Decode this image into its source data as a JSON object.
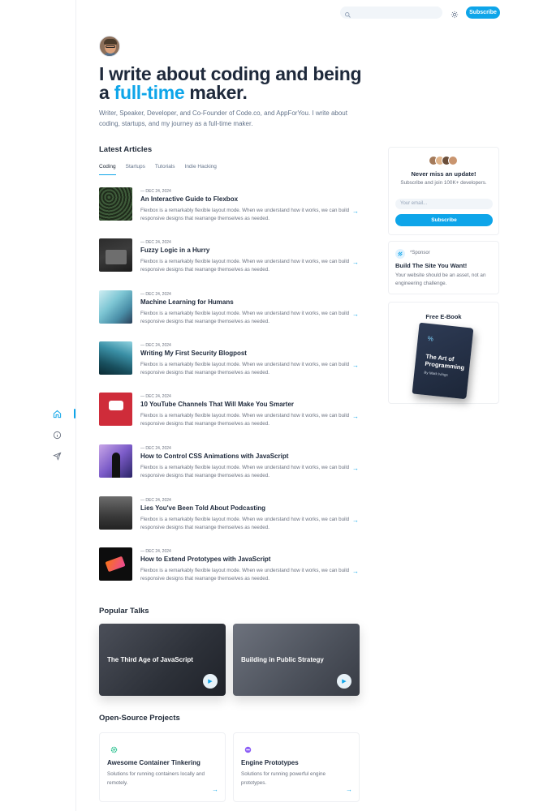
{
  "header": {
    "subscribe_label": "Subscribe"
  },
  "hero": {
    "title_part1": "I write about coding and being a ",
    "title_accent": "full-time",
    "title_part2": " maker.",
    "intro": "Writer, Speaker, Developer, and Co-Founder of Code.co, and AppForYou. I write about coding, startups, and my journey as a full-time maker."
  },
  "latest": {
    "heading": "Latest Articles",
    "tabs": [
      {
        "label": "Coding",
        "active": true
      },
      {
        "label": "Startups",
        "active": false
      },
      {
        "label": "Tutorials",
        "active": false
      },
      {
        "label": "Indie Hacking",
        "active": false
      }
    ],
    "articles": [
      {
        "date": "— DEC 24, 2024",
        "title": "An Interactive Guide to Flexbox",
        "desc": "Flexbox is a remarkably flexible layout mode. When we understand how it works, we can build responsive designs that rearrange themselves as needed."
      },
      {
        "date": "— DEC 24, 2024",
        "title": "Fuzzy Logic in a Hurry",
        "desc": "Flexbox is a remarkably flexible layout mode. When we understand how it works, we can build responsive designs that rearrange themselves as needed."
      },
      {
        "date": "— DEC 24, 2024",
        "title": "Machine Learning for Humans",
        "desc": "Flexbox is a remarkably flexible layout mode. When we understand how it works, we can build responsive designs that rearrange themselves as needed."
      },
      {
        "date": "— DEC 24, 2024",
        "title": "Writing My First Security Blogpost",
        "desc": "Flexbox is a remarkably flexible layout mode. When we understand how it works, we can build responsive designs that rearrange themselves as needed."
      },
      {
        "date": "— DEC 24, 2024",
        "title": "10 YouTube Channels That Will Make You Smarter",
        "desc": "Flexbox is a remarkably flexible layout mode. When we understand how it works, we can build responsive designs that rearrange themselves as needed."
      },
      {
        "date": "— DEC 24, 2024",
        "title": "How to Control CSS Animations with JavaScript",
        "desc": "Flexbox is a remarkably flexible layout mode. When we understand how it works, we can build responsive designs that rearrange themselves as needed."
      },
      {
        "date": "— DEC 24, 2024",
        "title": "Lies You've Been Told About Podcasting",
        "desc": "Flexbox is a remarkably flexible layout mode. When we understand how it works, we can build responsive designs that rearrange themselves as needed."
      },
      {
        "date": "— DEC 24, 2024",
        "title": "How to Extend Prototypes with JavaScript",
        "desc": "Flexbox is a remarkably flexible layout mode. When we understand how it works, we can build responsive designs that rearrange themselves as needed."
      }
    ]
  },
  "talks": {
    "heading": "Popular Talks",
    "items": [
      {
        "title": "The Third Age of JavaScript"
      },
      {
        "title": "Building in Public Strategy"
      }
    ]
  },
  "projects": {
    "heading": "Open-Source Projects",
    "items": [
      {
        "title": "Awesome Container Tinkering",
        "desc": "Solutions for running containers locally and remotely.",
        "icon_color": "#10b981"
      },
      {
        "title": "Engine Prototypes",
        "desc": "Solutions for running powerful engine prototypes.",
        "icon_color": "#8b5cf6"
      }
    ]
  },
  "newsletter": {
    "heading": "Never miss an update!",
    "text": "Subscribe and join 100K+ developers.",
    "email_placeholder": "Your email...",
    "button": "Subscribe"
  },
  "sponsor": {
    "tag": "*Sponsor",
    "heading": "Build The Site You Want!",
    "text": "Your website should be an asset, not an engineering challenge."
  },
  "ebook": {
    "heading": "Free E-Book",
    "book_title": "The Art of Programming",
    "book_author": "By Mark Ivings"
  },
  "colors": {
    "accent": "#0ea5e9"
  }
}
